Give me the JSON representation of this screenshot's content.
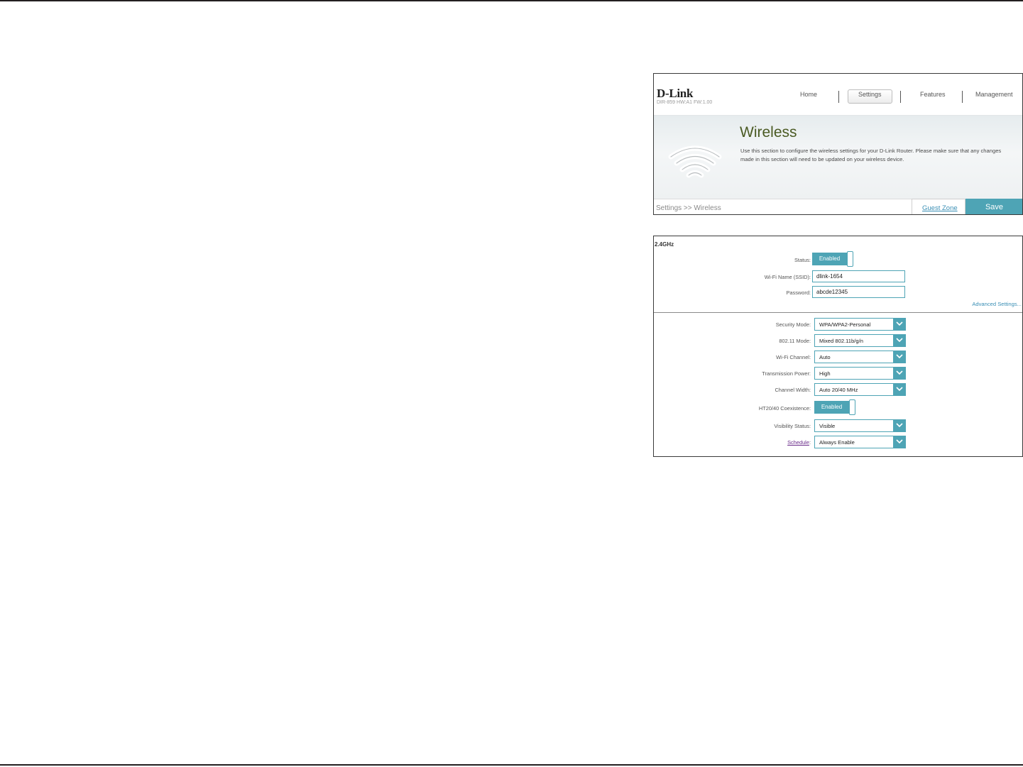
{
  "header": {
    "logo": "D-Link",
    "model": "DIR-859 HW:A1 FW:1.00",
    "nav": [
      {
        "label": "Home",
        "active": false
      },
      {
        "label": "Settings",
        "active": true
      },
      {
        "label": "Features",
        "active": false
      },
      {
        "label": "Management",
        "active": false
      }
    ],
    "title": "Wireless",
    "description": "Use this section to configure the wireless settings for your D-Link Router. Please make sure that any changes made in this section will need to be updated on your wireless device.",
    "breadcrumb": "Settings >> Wireless",
    "guest_zone_label": "Guest Zone",
    "save_label": "Save",
    "icon": "wifi-icon"
  },
  "band": {
    "title": "2.4GHz",
    "status": {
      "label": "Status:",
      "value": "Enabled"
    },
    "ssid": {
      "label": "Wi-Fi Name (SSID):",
      "value": "dlink-1654"
    },
    "password": {
      "label": "Password:",
      "value": "abcde12345"
    },
    "advanced_label": "Advanced Settings...",
    "security_mode": {
      "label": "Security Mode:",
      "value": "WPA/WPA2-Personal"
    },
    "mode_80211": {
      "label": "802.11 Mode:",
      "value": "Mixed 802.11b/g/n"
    },
    "channel": {
      "label": "Wi-Fi Channel:",
      "value": "Auto"
    },
    "tx_power": {
      "label": "Transmission Power:",
      "value": "High"
    },
    "channel_width": {
      "label": "Channel Width:",
      "value": "Auto 20/40 MHz"
    },
    "coexistence": {
      "label": "HT20/40 Coexistence:",
      "value": "Enabled"
    },
    "visibility": {
      "label": "Visibility Status:",
      "value": "Visible"
    },
    "schedule": {
      "label": "Schedule",
      "label_suffix": ":",
      "value": "Always Enable"
    }
  },
  "colors": {
    "accent": "#4ea4b5",
    "title_green": "#4a5a23",
    "link_blue": "#3a8fb5",
    "link_purple": "#6a2c8a"
  }
}
